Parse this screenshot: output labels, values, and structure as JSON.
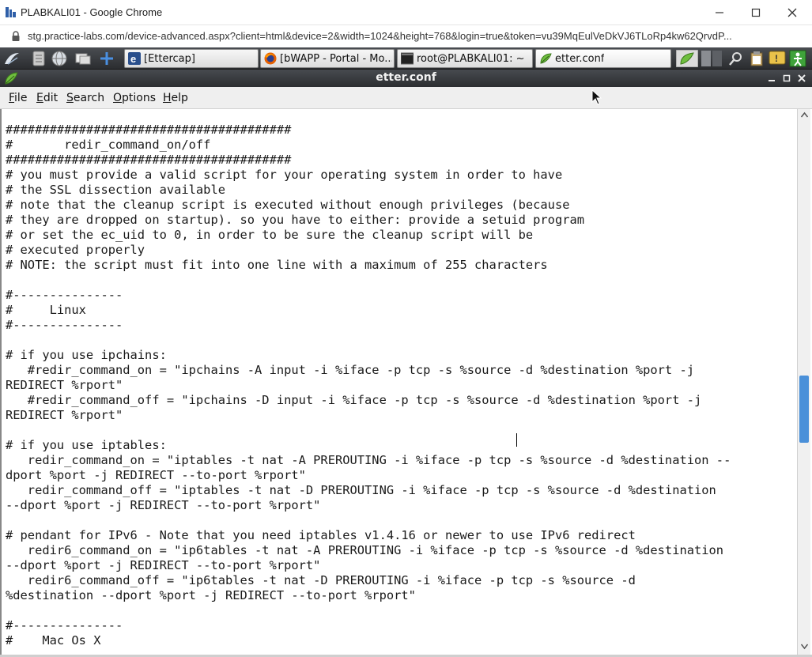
{
  "browser": {
    "window_title": "PLABKALI01 - Google Chrome",
    "url": "stg.practice-labs.com/device-advanced.aspx?client=html&device=2&width=1024&height=768&login=true&token=vu39MqEulVeDkVJ6TLoRp4kw62QrvdP..."
  },
  "taskbar": {
    "tasks": [
      {
        "label": "[Ettercap]",
        "icon": "ettercap-icon"
      },
      {
        "label": "[bWAPP - Portal - Mo...",
        "icon": "firefox-icon"
      },
      {
        "label": "root@PLABKALI01: ~",
        "icon": "terminal-icon"
      },
      {
        "label": "etter.conf",
        "icon": "text-editor-icon"
      }
    ]
  },
  "editor_window": {
    "title": "etter.conf",
    "menus": [
      {
        "label": "File",
        "mnemonic": "F",
        "rest": "ile"
      },
      {
        "label": "Edit",
        "mnemonic": "E",
        "rest": "dit"
      },
      {
        "label": "Search",
        "mnemonic": "S",
        "rest": "earch"
      },
      {
        "label": "Options",
        "mnemonic": "O",
        "rest": "ptions"
      },
      {
        "label": "Help",
        "mnemonic": "H",
        "rest": "elp"
      }
    ],
    "lines": [
      "#######################################",
      "#       redir_command_on/off",
      "#######################################",
      "# you must provide a valid script for your operating system in order to have",
      "# the SSL dissection available",
      "# note that the cleanup script is executed without enough privileges (because",
      "# they are dropped on startup). so you have to either: provide a setuid program",
      "# or set the ec_uid to 0, in order to be sure the cleanup script will be",
      "# executed properly",
      "# NOTE: the script must fit into one line with a maximum of 255 characters",
      "",
      "#---------------",
      "#     Linux",
      "#---------------",
      "",
      "# if you use ipchains:",
      "   #redir_command_on = \"ipchains -A input -i %iface -p tcp -s %source -d %destination %port -j",
      "REDIRECT %rport\"",
      "   #redir_command_off = \"ipchains -D input -i %iface -p tcp -s %source -d %destination %port -j",
      "REDIRECT %rport\"",
      "",
      "# if you use iptables:",
      "   redir_command_on = \"iptables -t nat -A PREROUTING -i %iface -p tcp -s %source -d %destination --",
      "dport %port -j REDIRECT --to-port %rport\"",
      "   redir_command_off = \"iptables -t nat -D PREROUTING -i %iface -p tcp -s %source -d %destination",
      "--dport %port -j REDIRECT --to-port %rport\"",
      "",
      "# pendant for IPv6 - Note that you need iptables v1.4.16 or newer to use IPv6 redirect",
      "   redir6_command_on = \"ip6tables -t nat -A PREROUTING -i %iface -p tcp -s %source -d %destination",
      "--dport %port -j REDIRECT --to-port %rport\"",
      "   redir6_command_off = \"ip6tables -t nat -D PREROUTING -i %iface -p tcp -s %source -d",
      "%destination --dport %port -j REDIRECT --to-port %rport\"",
      "",
      "#---------------",
      "#    Mac Os X"
    ]
  },
  "scroll": {
    "position": 0.56,
    "visible_fraction": 0.13
  },
  "colors": {
    "scroll_thumb": "#4a90d9",
    "panel": "#3a3c40"
  }
}
